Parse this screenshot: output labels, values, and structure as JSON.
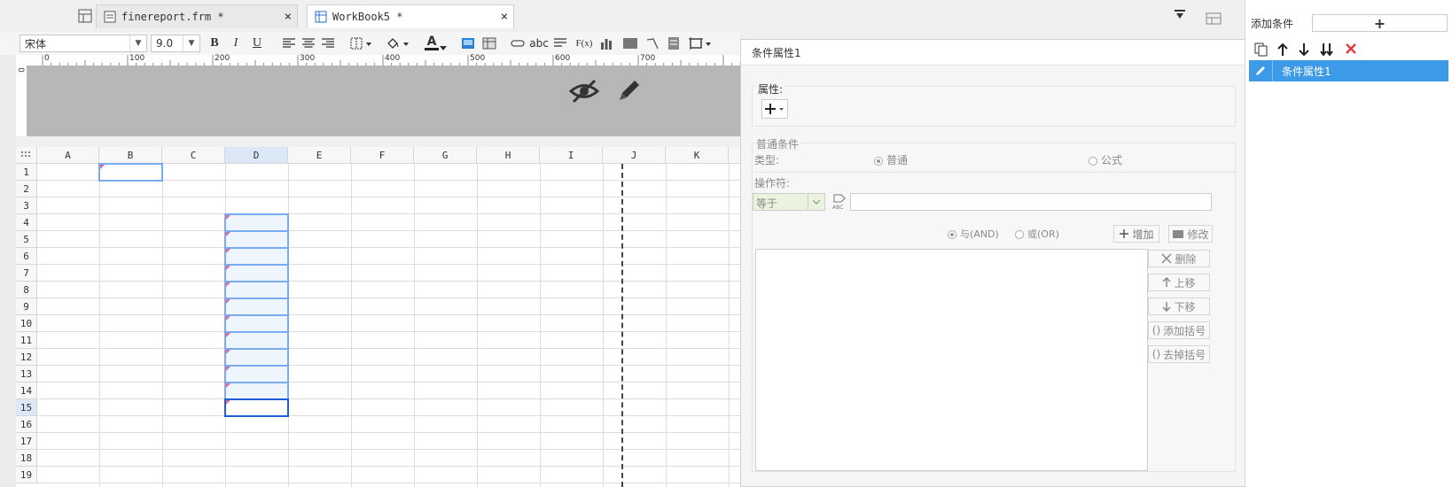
{
  "tabs": [
    {
      "label": "finereport.frm *",
      "close": "×"
    },
    {
      "label": "WorkBook5 *",
      "close": "×"
    }
  ],
  "toolbar": {
    "font_name": "宋体",
    "font_size": "9.0",
    "bold": "B",
    "italic": "I",
    "underline": "U",
    "text_a": "A",
    "abc": "abc",
    "fx": "F(x)"
  },
  "ruler": {
    "ticks": [
      "0",
      "100",
      "200",
      "300",
      "400",
      "500",
      "600",
      "700"
    ]
  },
  "grid": {
    "columns": [
      "A",
      "B",
      "C",
      "D",
      "E",
      "F",
      "G",
      "H",
      "I",
      "J",
      "K"
    ],
    "rows": [
      "1",
      "2",
      "3",
      "4",
      "5",
      "6",
      "7",
      "8",
      "9",
      "10",
      "11",
      "12",
      "13",
      "14",
      "15",
      "16",
      "17",
      "18",
      "19"
    ]
  },
  "dialog": {
    "title": "条件属性1",
    "attr_label": "属性:",
    "normal_cond": "普通条件",
    "type_label": "类型:",
    "type_normal": "普通",
    "type_formula": "公式",
    "operator_label": "操作符:",
    "operator_value": "等于",
    "and_label": "与(AND)",
    "or_label": "或(OR)",
    "add_btn": "增加",
    "edit_btn": "修改",
    "delete_btn": "删除",
    "up_btn": "上移",
    "down_btn": "下移",
    "add_paren_btn": "添加括号",
    "remove_paren_btn": "去掉括号"
  },
  "right_panel": {
    "add_condition_label": "添加条件",
    "add_plus": "+",
    "list_item": "条件属性1"
  },
  "colors": {
    "accent": "#3d9ae8",
    "selection_border": "#7aaaf0",
    "delete_red": "#e23b3b"
  }
}
